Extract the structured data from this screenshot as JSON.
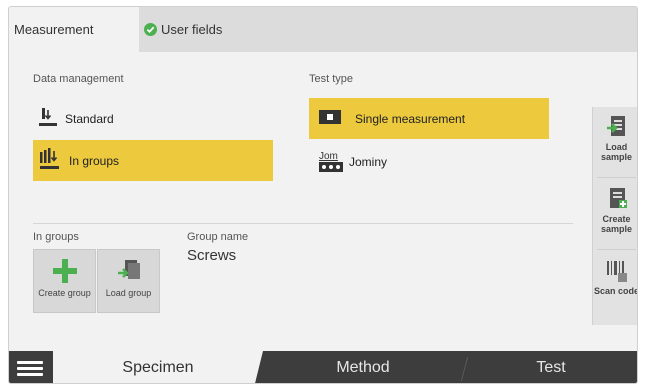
{
  "tabs": {
    "measurement": "Measurement",
    "user_fields": "User fields"
  },
  "data_management": {
    "label": "Data management",
    "standard": "Standard",
    "in_groups": "In groups",
    "selected": "In groups"
  },
  "test_type": {
    "label": "Test type",
    "single": "Single measurement",
    "jominy": "Jominy",
    "jominy_icon_text": "Jom",
    "selected": "Single measurement"
  },
  "groups": {
    "label": "In groups",
    "create_group": "Create group",
    "load_group": "Load group"
  },
  "group_name": {
    "label": "Group name",
    "value": "Screws"
  },
  "side": {
    "load_sample": "Load sample",
    "create_sample": "Create sample",
    "scan_code": "Scan code"
  },
  "bottom_nav": {
    "specimen": "Specimen",
    "method": "Method",
    "test": "Test",
    "active": "Specimen"
  },
  "colors": {
    "accent": "#ecc93d",
    "nav_bg": "#3d3d3d",
    "green": "#4caf50"
  }
}
